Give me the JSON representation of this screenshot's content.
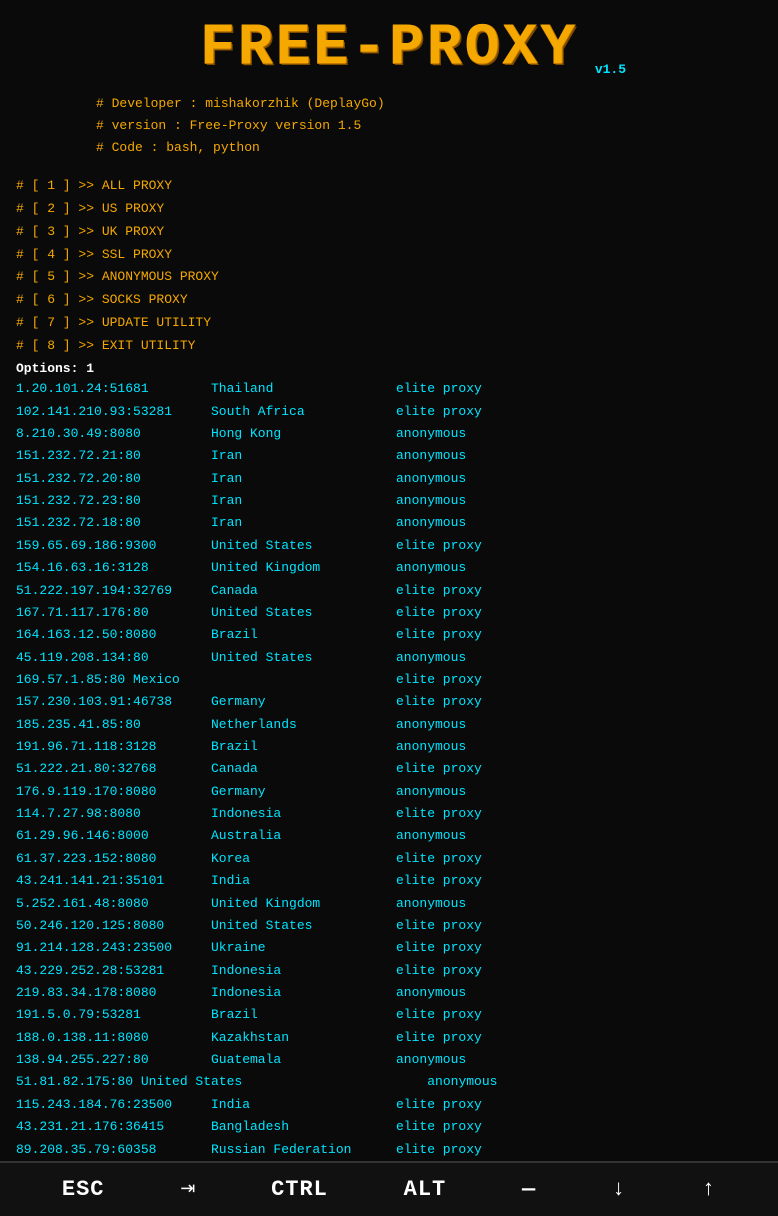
{
  "header": {
    "logo": "FREE-PROXY",
    "version": "v1.5",
    "info_lines": [
      "# Developer : mishakorzhik (DeplayGo)",
      "# version : Free-Proxy version 1.5",
      "# Code   : bash, python"
    ]
  },
  "menu": {
    "options_label": "Options: 1",
    "items": [
      "# [ 1 ] >> ALL PROXY",
      "# [ 2 ] >> US PROXY",
      "# [ 3 ] >> UK PROXY",
      "# [ 4 ] >> SSL PROXY",
      "# [ 5 ] >> ANONYMOUS PROXY",
      "# [ 6 ] >> SOCKS PROXY",
      "# [ 7 ] >> UPDATE UTILITY",
      "# [ 8 ] >> EXIT UTILITY"
    ]
  },
  "proxies": [
    {
      "ip": "1.20.101.24:51681",
      "country": "Thailand",
      "type": "elite proxy"
    },
    {
      "ip": "102.141.210.93:53281",
      "country": "South Africa",
      "type": "elite proxy"
    },
    {
      "ip": "8.210.30.49:8080",
      "country": "Hong Kong",
      "type": "anonymous"
    },
    {
      "ip": "151.232.72.21:80",
      "country": "Iran",
      "type": "anonymous"
    },
    {
      "ip": "151.232.72.20:80",
      "country": "Iran",
      "type": "anonymous"
    },
    {
      "ip": "151.232.72.23:80",
      "country": "Iran",
      "type": "anonymous"
    },
    {
      "ip": "151.232.72.18:80",
      "country": "Iran",
      "type": "anonymous"
    },
    {
      "ip": "159.65.69.186:9300",
      "country": "United States",
      "type": "elite proxy"
    },
    {
      "ip": "154.16.63.16:3128",
      "country": "United Kingdom",
      "type": "anonymous"
    },
    {
      "ip": "51.222.197.194:32769",
      "country": "Canada",
      "type": "elite proxy"
    },
    {
      "ip": "167.71.117.176:80",
      "country": "United States",
      "type": "elite proxy"
    },
    {
      "ip": "164.163.12.50:8080",
      "country": "Brazil",
      "type": "elite proxy"
    },
    {
      "ip": "45.119.208.134:80",
      "country": "United States",
      "type": "anonymous"
    },
    {
      "ip": "169.57.1.85:80  Mexico",
      "country": "",
      "type": "elite proxy"
    },
    {
      "ip": "157.230.103.91:46738",
      "country": "Germany",
      "type": "elite proxy"
    },
    {
      "ip": "185.235.41.85:80",
      "country": "Netherlands",
      "type": "anonymous"
    },
    {
      "ip": "191.96.71.118:3128",
      "country": "Brazil",
      "type": "anonymous"
    },
    {
      "ip": "51.222.21.80:32768",
      "country": "Canada",
      "type": "elite proxy"
    },
    {
      "ip": "176.9.119.170:8080",
      "country": "Germany",
      "type": "anonymous"
    },
    {
      "ip": "114.7.27.98:8080",
      "country": "Indonesia",
      "type": "elite proxy"
    },
    {
      "ip": "61.29.96.146:8000",
      "country": "Australia",
      "type": "anonymous"
    },
    {
      "ip": "61.37.223.152:8080",
      "country": "Korea",
      "type": "elite proxy"
    },
    {
      "ip": "43.241.141.21:35101",
      "country": "India",
      "type": "elite proxy"
    },
    {
      "ip": "5.252.161.48:8080",
      "country": "United Kingdom",
      "type": "anonymous"
    },
    {
      "ip": "50.246.120.125:8080",
      "country": "United States",
      "type": "elite proxy"
    },
    {
      "ip": "91.214.128.243:23500",
      "country": "Ukraine",
      "type": "elite proxy"
    },
    {
      "ip": "43.229.252.28:53281",
      "country": "Indonesia",
      "type": "elite proxy"
    },
    {
      "ip": "219.83.34.178:8080",
      "country": "Indonesia",
      "type": "anonymous"
    },
    {
      "ip": "191.5.0.79:53281",
      "country": "Brazil",
      "type": "elite proxy"
    },
    {
      "ip": "188.0.138.11:8080",
      "country": "Kazakhstan",
      "type": "elite proxy"
    },
    {
      "ip": "138.94.255.227:80",
      "country": "Guatemala",
      "type": "anonymous"
    },
    {
      "ip": "51.81.82.175:80 United States",
      "country": "",
      "type": "anonymous"
    },
    {
      "ip": "115.243.184.76:23500",
      "country": "India",
      "type": "elite proxy"
    },
    {
      "ip": "43.231.21.176:36415",
      "country": "Bangladesh",
      "type": "elite proxy"
    },
    {
      "ip": "89.208.35.79:60358",
      "country": "Russian Federation",
      "type": "elite proxy"
    }
  ],
  "bottom_bar": {
    "keys": [
      "ESC",
      "CTRL",
      "ALT",
      "—",
      "↓",
      "↑"
    ],
    "tab_icon": "⇥"
  }
}
